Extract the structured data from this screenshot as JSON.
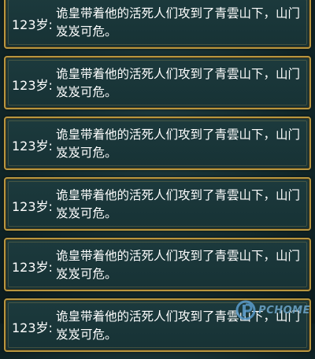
{
  "log": {
    "entries": [
      {
        "age": "123岁",
        "colon": ":",
        "message": "诡皇带着他的活死人们攻到了青雲山下，山门岌岌可危。"
      },
      {
        "age": "123岁",
        "colon": ":",
        "message": "诡皇带着他的活死人们攻到了青雲山下，山门岌岌可危。"
      },
      {
        "age": "123岁",
        "colon": ":",
        "message": "诡皇带着他的活死人们攻到了青雲山下，山门岌岌可危。"
      },
      {
        "age": "123岁",
        "colon": ":",
        "message": "诡皇带着他的活死人们攻到了青雲山下，山门岌岌可危。"
      },
      {
        "age": "123岁",
        "colon": ":",
        "message": "诡皇带着他的活死人们攻到了青雲山下，山门岌岌可危。"
      },
      {
        "age": "123岁",
        "colon": ":",
        "message": "诡皇带着他的活死人们攻到了青雲山下，山门岌岌可危。"
      }
    ]
  },
  "watermark": {
    "icon": "pc-logo-icon",
    "text": "PCHOME"
  }
}
